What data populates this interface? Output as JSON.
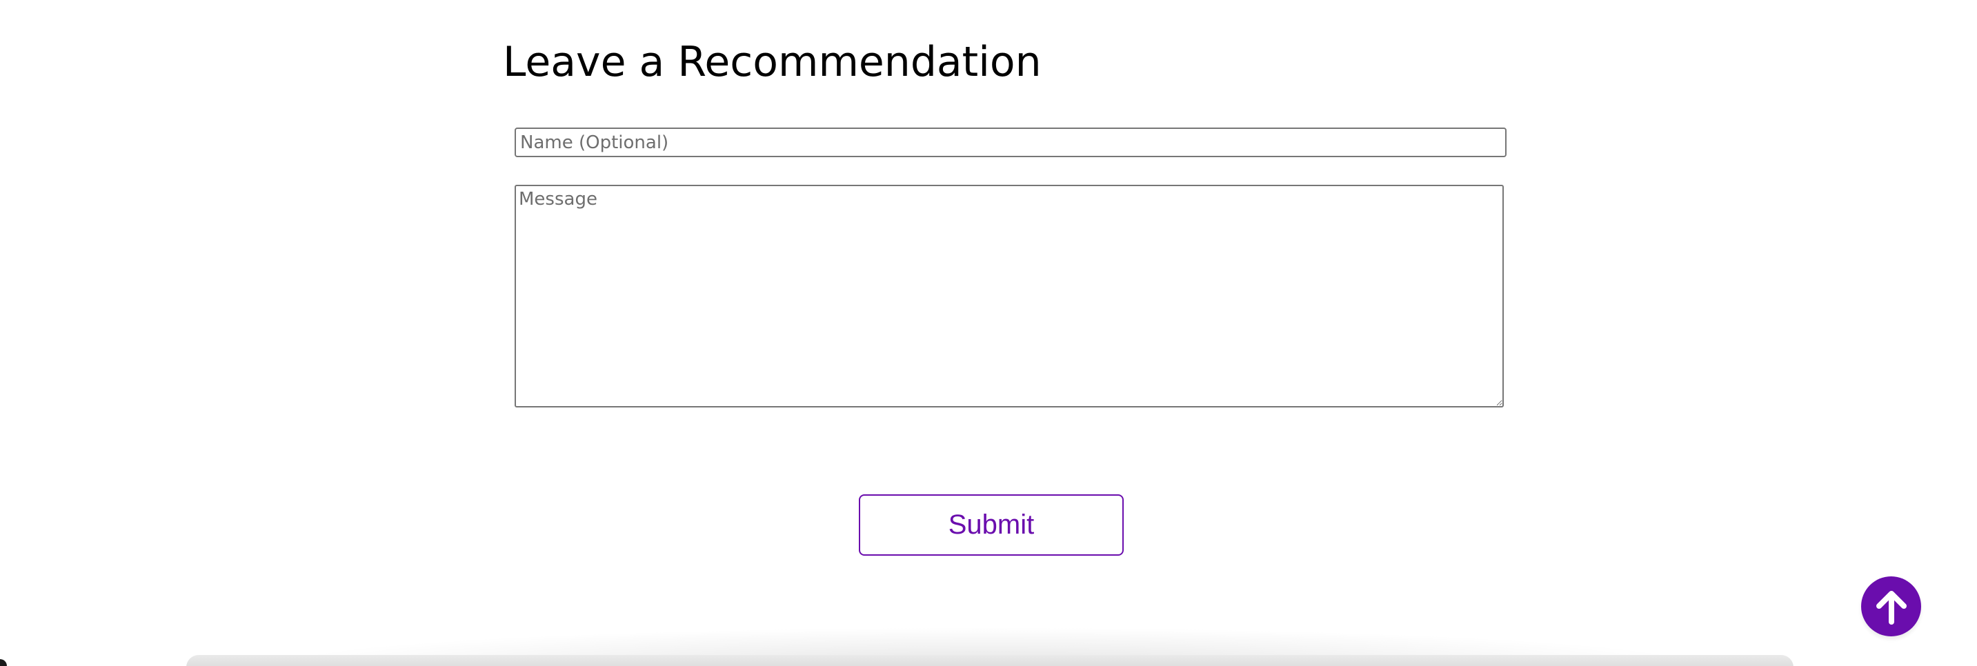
{
  "form": {
    "heading": "Leave a Recommendation",
    "name_placeholder": "Name (Optional)",
    "message_placeholder": "Message",
    "submit_label": "Submit"
  },
  "scroll_top": {
    "icon": "arrow-up-icon"
  },
  "colors": {
    "accent": "#6a0dad",
    "text": "#000000",
    "border": "#767676",
    "placeholder": "#6e6e6e",
    "background": "#ffffff"
  }
}
